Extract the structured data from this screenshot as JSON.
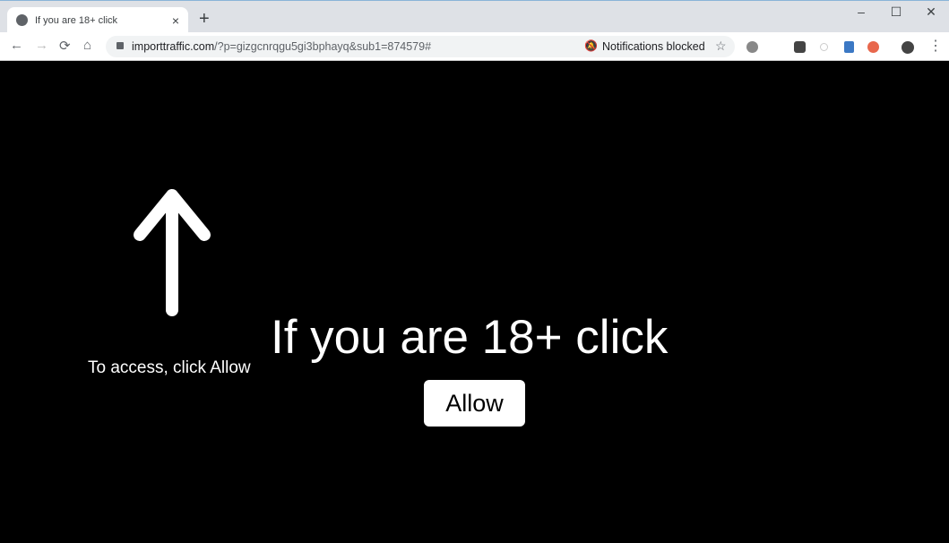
{
  "tab": {
    "title": "If you are 18+ click",
    "close": "×",
    "new_tab": "+"
  },
  "window": {
    "minimize": "–",
    "maximize": "☐",
    "close": "✕"
  },
  "nav": {
    "back": "←",
    "forward": "→",
    "reload": "⟳",
    "home": "⌂"
  },
  "address": {
    "host": "importtraffic.com",
    "path": "/?p=gizgcnrqgu5gi3bphayq&sub1=874579#"
  },
  "notification_status": "Notifications blocked",
  "star": "☆",
  "menu": "⋮",
  "page": {
    "access_text": "To access, click Allow",
    "headline": "If you are 18+ click",
    "allow_label": "Allow"
  }
}
